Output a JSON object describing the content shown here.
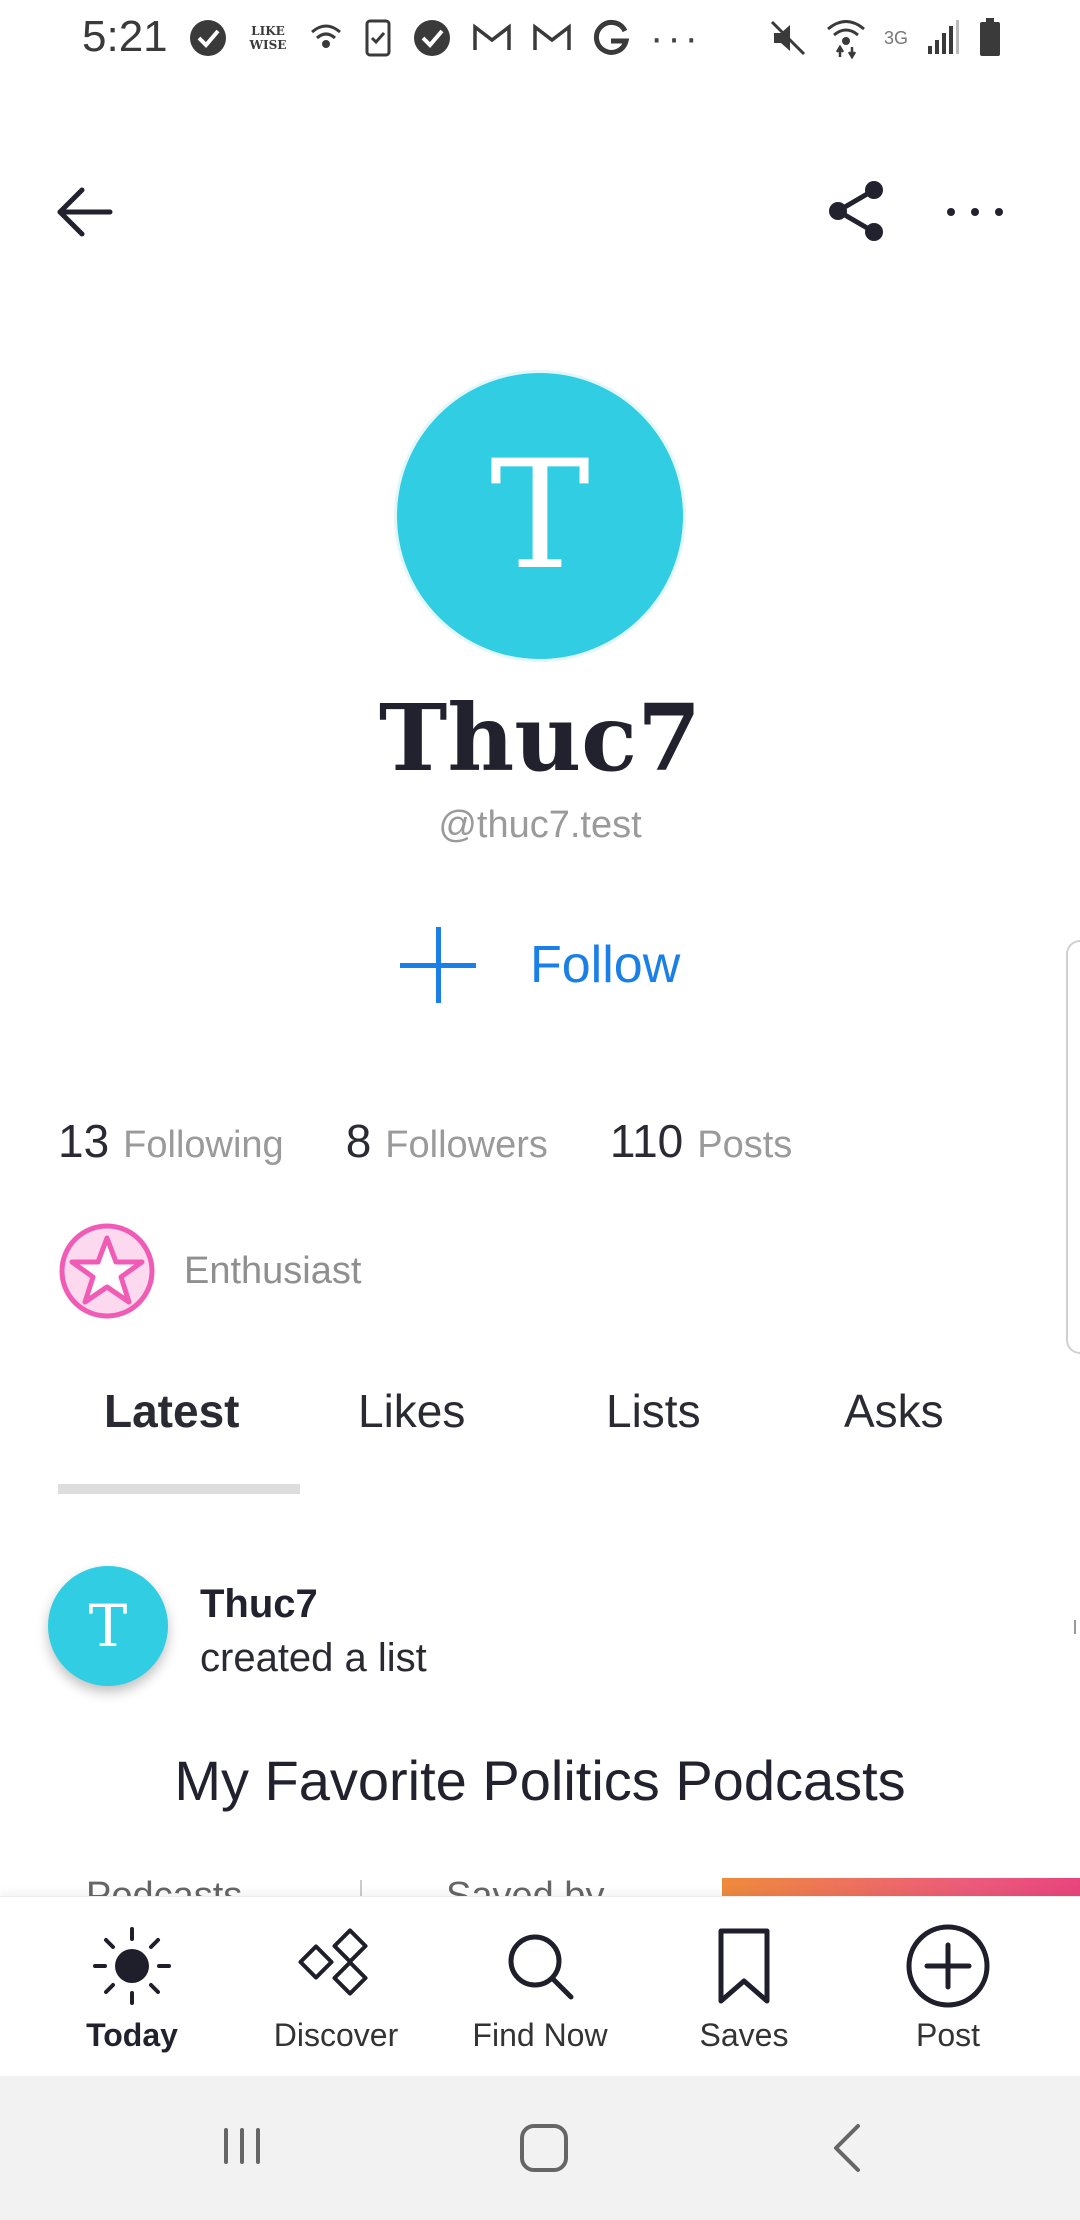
{
  "status_bar": {
    "time": "5:21",
    "left_icons": [
      "check-circle-icon",
      "likewise-icon",
      "wifi-calling-icon",
      "clipboard-icon",
      "check-circle-icon",
      "gmail-icon",
      "gmail-icon",
      "google-icon"
    ],
    "overflow": "···",
    "right_icons": [
      "mute-icon",
      "wifi-icon",
      "signal-icon",
      "battery-icon"
    ],
    "network": "3G"
  },
  "profile": {
    "avatar_letter": "T",
    "avatar_color": "#31cde3",
    "name": "Thuc7",
    "handle": "@thuc7.test",
    "follow_label": "Follow",
    "accent": "#1a7fe6"
  },
  "stats": [
    {
      "value": "13",
      "label": "Following"
    },
    {
      "value": "8",
      "label": "Followers"
    },
    {
      "value": "110",
      "label": "Posts"
    }
  ],
  "badge": {
    "label": "Enthusiast",
    "color": "#f05bb5"
  },
  "tabs": [
    {
      "label": "Latest",
      "active": true
    },
    {
      "label": "Likes",
      "active": false
    },
    {
      "label": "Lists",
      "active": false
    },
    {
      "label": "Asks",
      "active": false
    }
  ],
  "feed": {
    "avatar_letter": "T",
    "user": "Thuc7",
    "action": "created a list",
    "title": "My Favorite Politics Podcasts",
    "peek_left": "Podcasts",
    "peek_mid": "Saved by"
  },
  "bottom_nav": [
    {
      "label": "Today",
      "icon": "sun-icon",
      "active": true
    },
    {
      "label": "Discover",
      "icon": "discover-icon",
      "active": false
    },
    {
      "label": "Find Now",
      "icon": "search-icon",
      "active": false
    },
    {
      "label": "Saves",
      "icon": "bookmark-icon",
      "active": false
    },
    {
      "label": "Post",
      "icon": "plus-circle-icon",
      "active": false
    }
  ]
}
